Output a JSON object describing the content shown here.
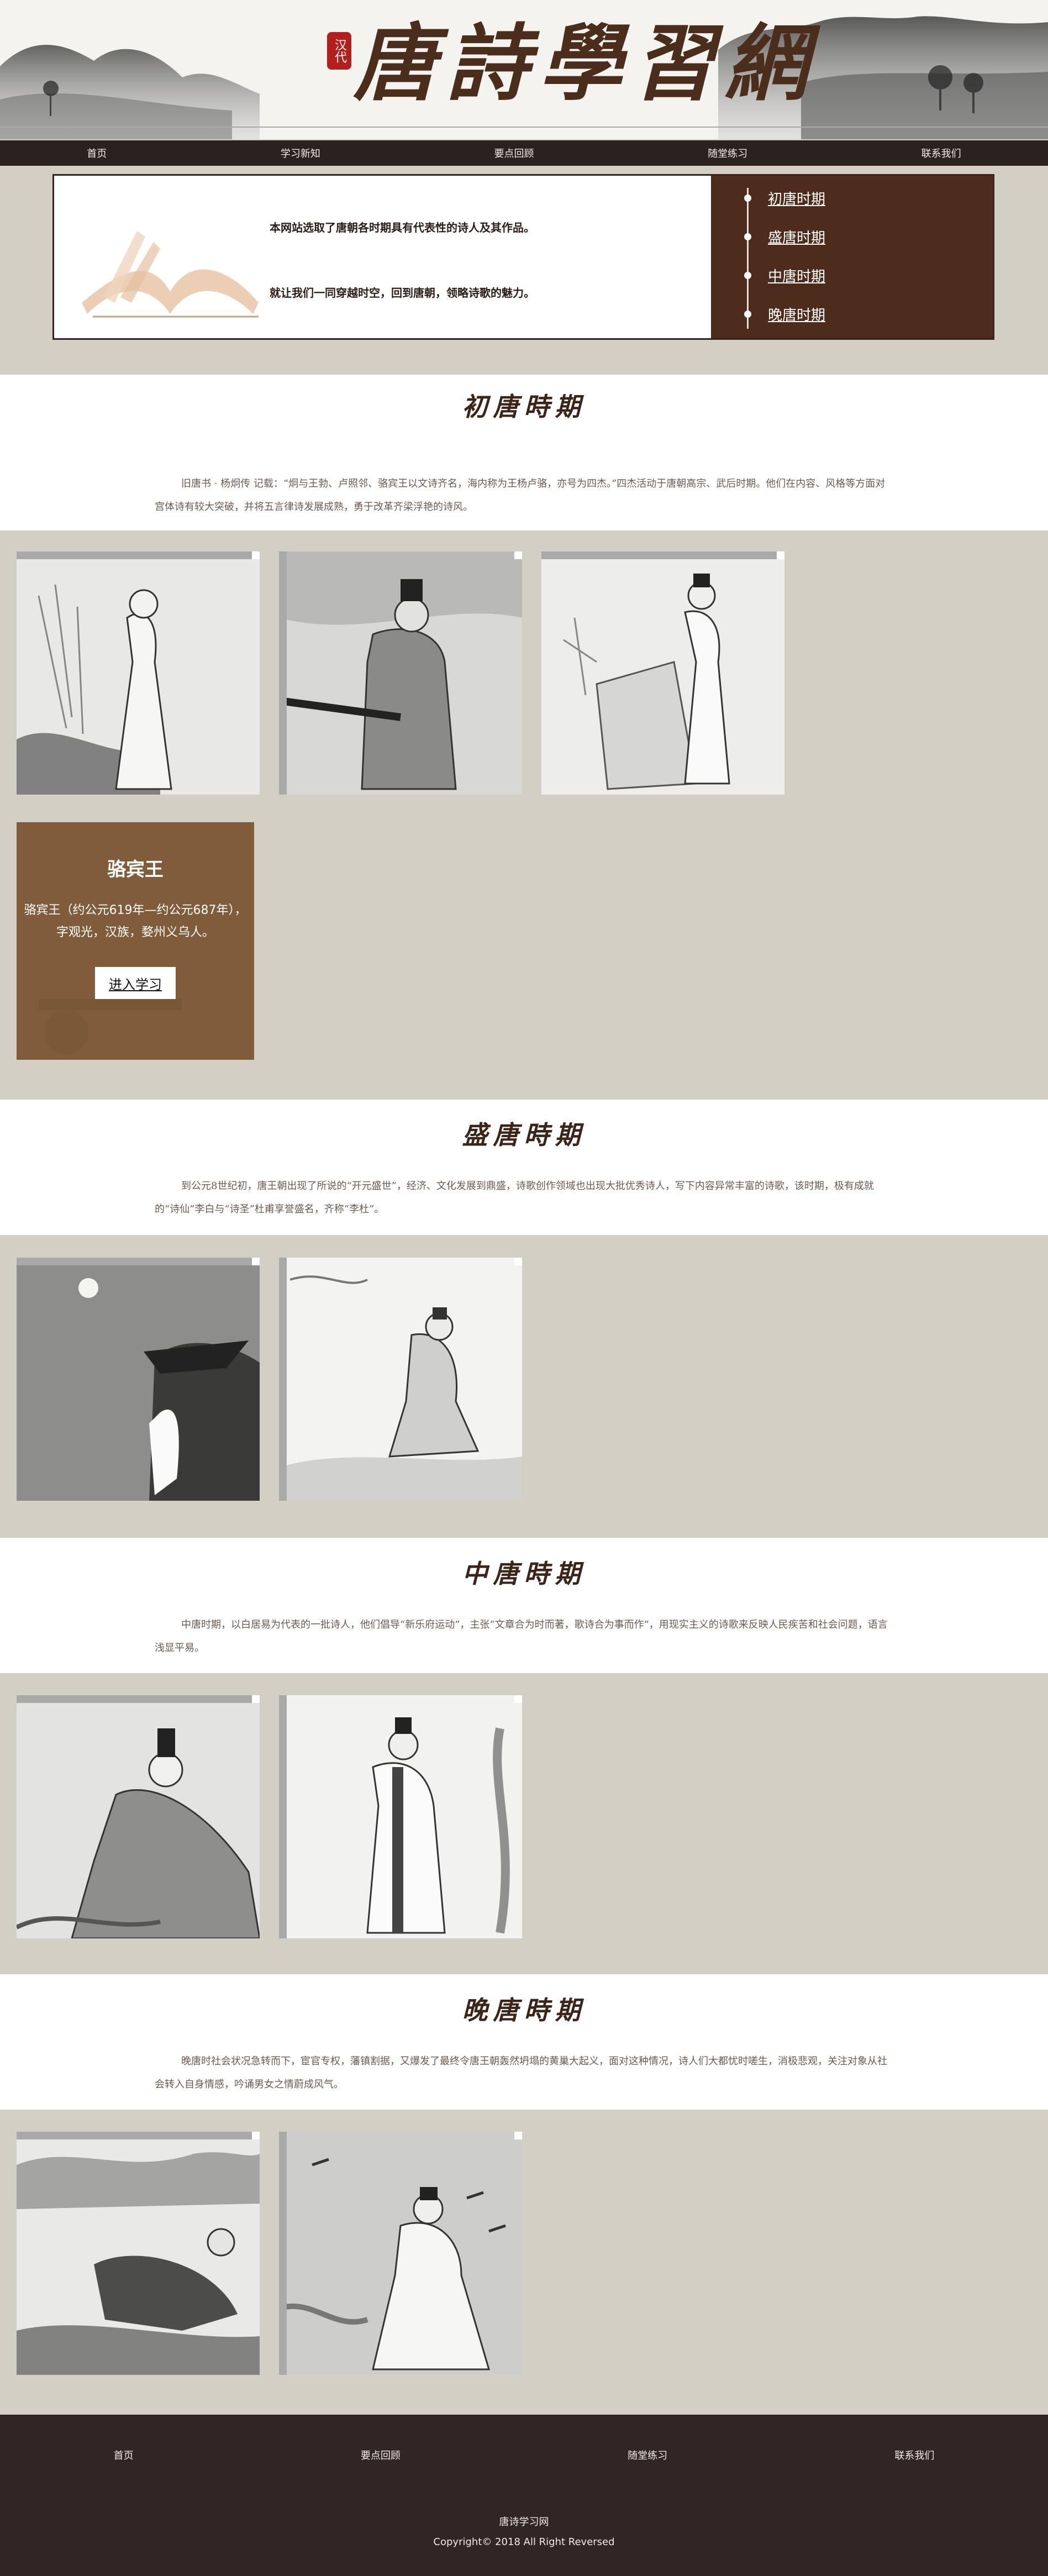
{
  "banner": {
    "title": "唐詩學習網",
    "seal_text": "汉代"
  },
  "nav": [
    "首页",
    "学习新知",
    "要点回顾",
    "随堂练习",
    "联系我们"
  ],
  "intro": {
    "line1": "本网站选取了唐朝各时期具有代表性的诗人及其作品。",
    "line2": "就让我们一同穿越时空，回到唐朝，领略诗歌的魅力。",
    "eras": [
      "初唐时期",
      "盛唐时期",
      "中唐时期",
      "晚唐时期"
    ]
  },
  "sections": [
    {
      "title": "初唐時期",
      "desc": "旧唐书 · 杨炯传  记载：“炯与王勃、卢照邻、骆宾王以文诗齐名，海内称为王杨卢骆，亦号为四杰。”四杰活动于唐朝高宗、武后时期。他们在内容、风格等方面对宫体诗有较大突破，并将五言律诗发展成熟，勇于改革齐梁浮艳的诗风。"
    },
    {
      "title": "盛唐時期",
      "desc": "到公元8世纪初，唐王朝出现了所说的“开元盛世”，经济、文化发展到鼎盛，诗歌创作领域也出现大批优秀诗人，写下内容异常丰富的诗歌，该时期，极有成就的“诗仙”李白与“诗圣”杜甫享誉盛名，齐称“李杜”。"
    },
    {
      "title": "中唐時期",
      "desc": "中唐时期，以白居易为代表的一批诗人，他们倡导“新乐府运动”，主张“文章合为时而著，歌诗合为事而作”，用现实主义的诗歌来反映人民疾苦和社会问题，语言浅显平易。"
    },
    {
      "title": "晚唐時期",
      "desc": "晚唐时社会状况急转而下，宦官专权，藩镇割据，又爆发了最终令唐王朝轰然坍塌的黄巢大起义，面对这种情况，诗人们大都忧时嗟生，消极悲观，关注对象从社会转入自身情感，吟诵男女之情蔚成风气。"
    }
  ],
  "poet_card": {
    "name": "骆宾王",
    "bio_line1": "骆宾王（约公元619年—约公元687年），",
    "bio_line2": "字观光，汉族，婺州义乌人。",
    "button": "进入学习"
  },
  "footer": {
    "nav": [
      "首页",
      "要点回顾",
      "随堂练习",
      "联系我们"
    ],
    "site_name": "唐诗学习网",
    "copyright": "Copyright© 2018 All Right Reversed"
  },
  "colors": {
    "page_bg": "#d3cfc4",
    "nav_bg": "#2b2220",
    "era_menu_bg": "#4d2c1b",
    "title_color": "#3b2418",
    "footer_bg": "#312624"
  }
}
